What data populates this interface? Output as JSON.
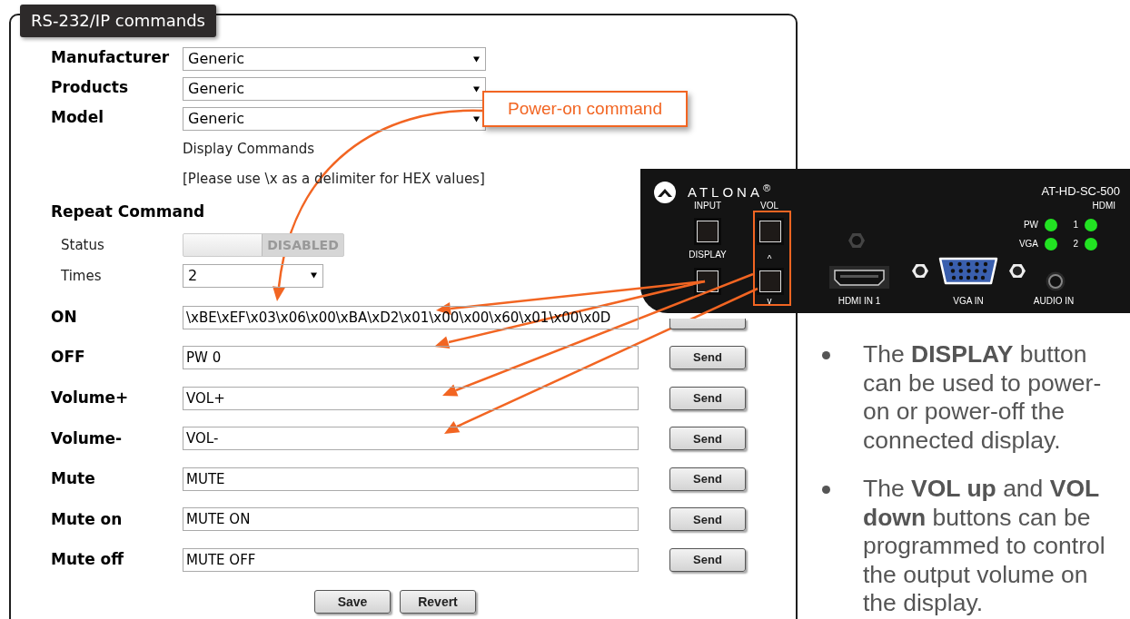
{
  "panel": {
    "title": "RS-232/IP commands"
  },
  "selects": [
    {
      "label": "Manufacturer",
      "value": "Generic"
    },
    {
      "label": "Products",
      "value": "Generic"
    },
    {
      "label": "Model",
      "value": "Generic"
    }
  ],
  "section_label": "Display Commands",
  "hint": "[Please use \\x as a delimiter for HEX values]",
  "repeat": {
    "heading": "Repeat Command",
    "status_label": "Status",
    "status": {
      "on": false,
      "text": "DISABLED"
    },
    "times_label": "Times",
    "times": "2"
  },
  "commands": [
    {
      "label": "ON",
      "value": "\\xBE\\xEF\\x03\\x06\\x00\\xBA\\xD2\\x01\\x00\\x00\\x60\\x01\\x00\\x0D"
    },
    {
      "label": "OFF",
      "value": "PW 0",
      "button": "Send"
    },
    {
      "label": "Volume+",
      "value": "VOL+",
      "button": "Send"
    },
    {
      "label": "Volume-",
      "value": "VOL-",
      "button": "Send"
    },
    {
      "label": "Mute",
      "value": "MUTE",
      "button": "Send"
    },
    {
      "label": "Mute on",
      "value": "MUTE ON",
      "button": "Send"
    },
    {
      "label": "Mute off",
      "value": "MUTE OFF",
      "button": "Send"
    }
  ],
  "buttons": [
    "Save",
    "Revert"
  ],
  "callout": "Power-on command",
  "device": {
    "brand": "ATLONA$^{®}$",
    "model": "AT-HD-SC-500",
    "hdmi_label": "HDMI",
    "leds": [
      {
        "label": "PW",
        "on": true
      },
      {
        "label": "VGA",
        "on": true
      }
    ],
    "hdmi_leds": [
      {
        "label": "1",
        "on": true
      },
      {
        "label": "2",
        "on": true
      }
    ],
    "input_label": "INPUT",
    "display_label": "DISPLAY",
    "vol_label": "VOL",
    "vol_up": "^",
    "vol_down": "v",
    "ports": [
      "HDMI IN 1",
      "VGA IN",
      "AUDIO IN"
    ]
  },
  "notes": [
    "The **DISPLAY** button can be used to power-on or power-off the connected display.",
    "The **VOL up** and **VOL down** buttons can be programmed to control the output volume on the display."
  ]
}
